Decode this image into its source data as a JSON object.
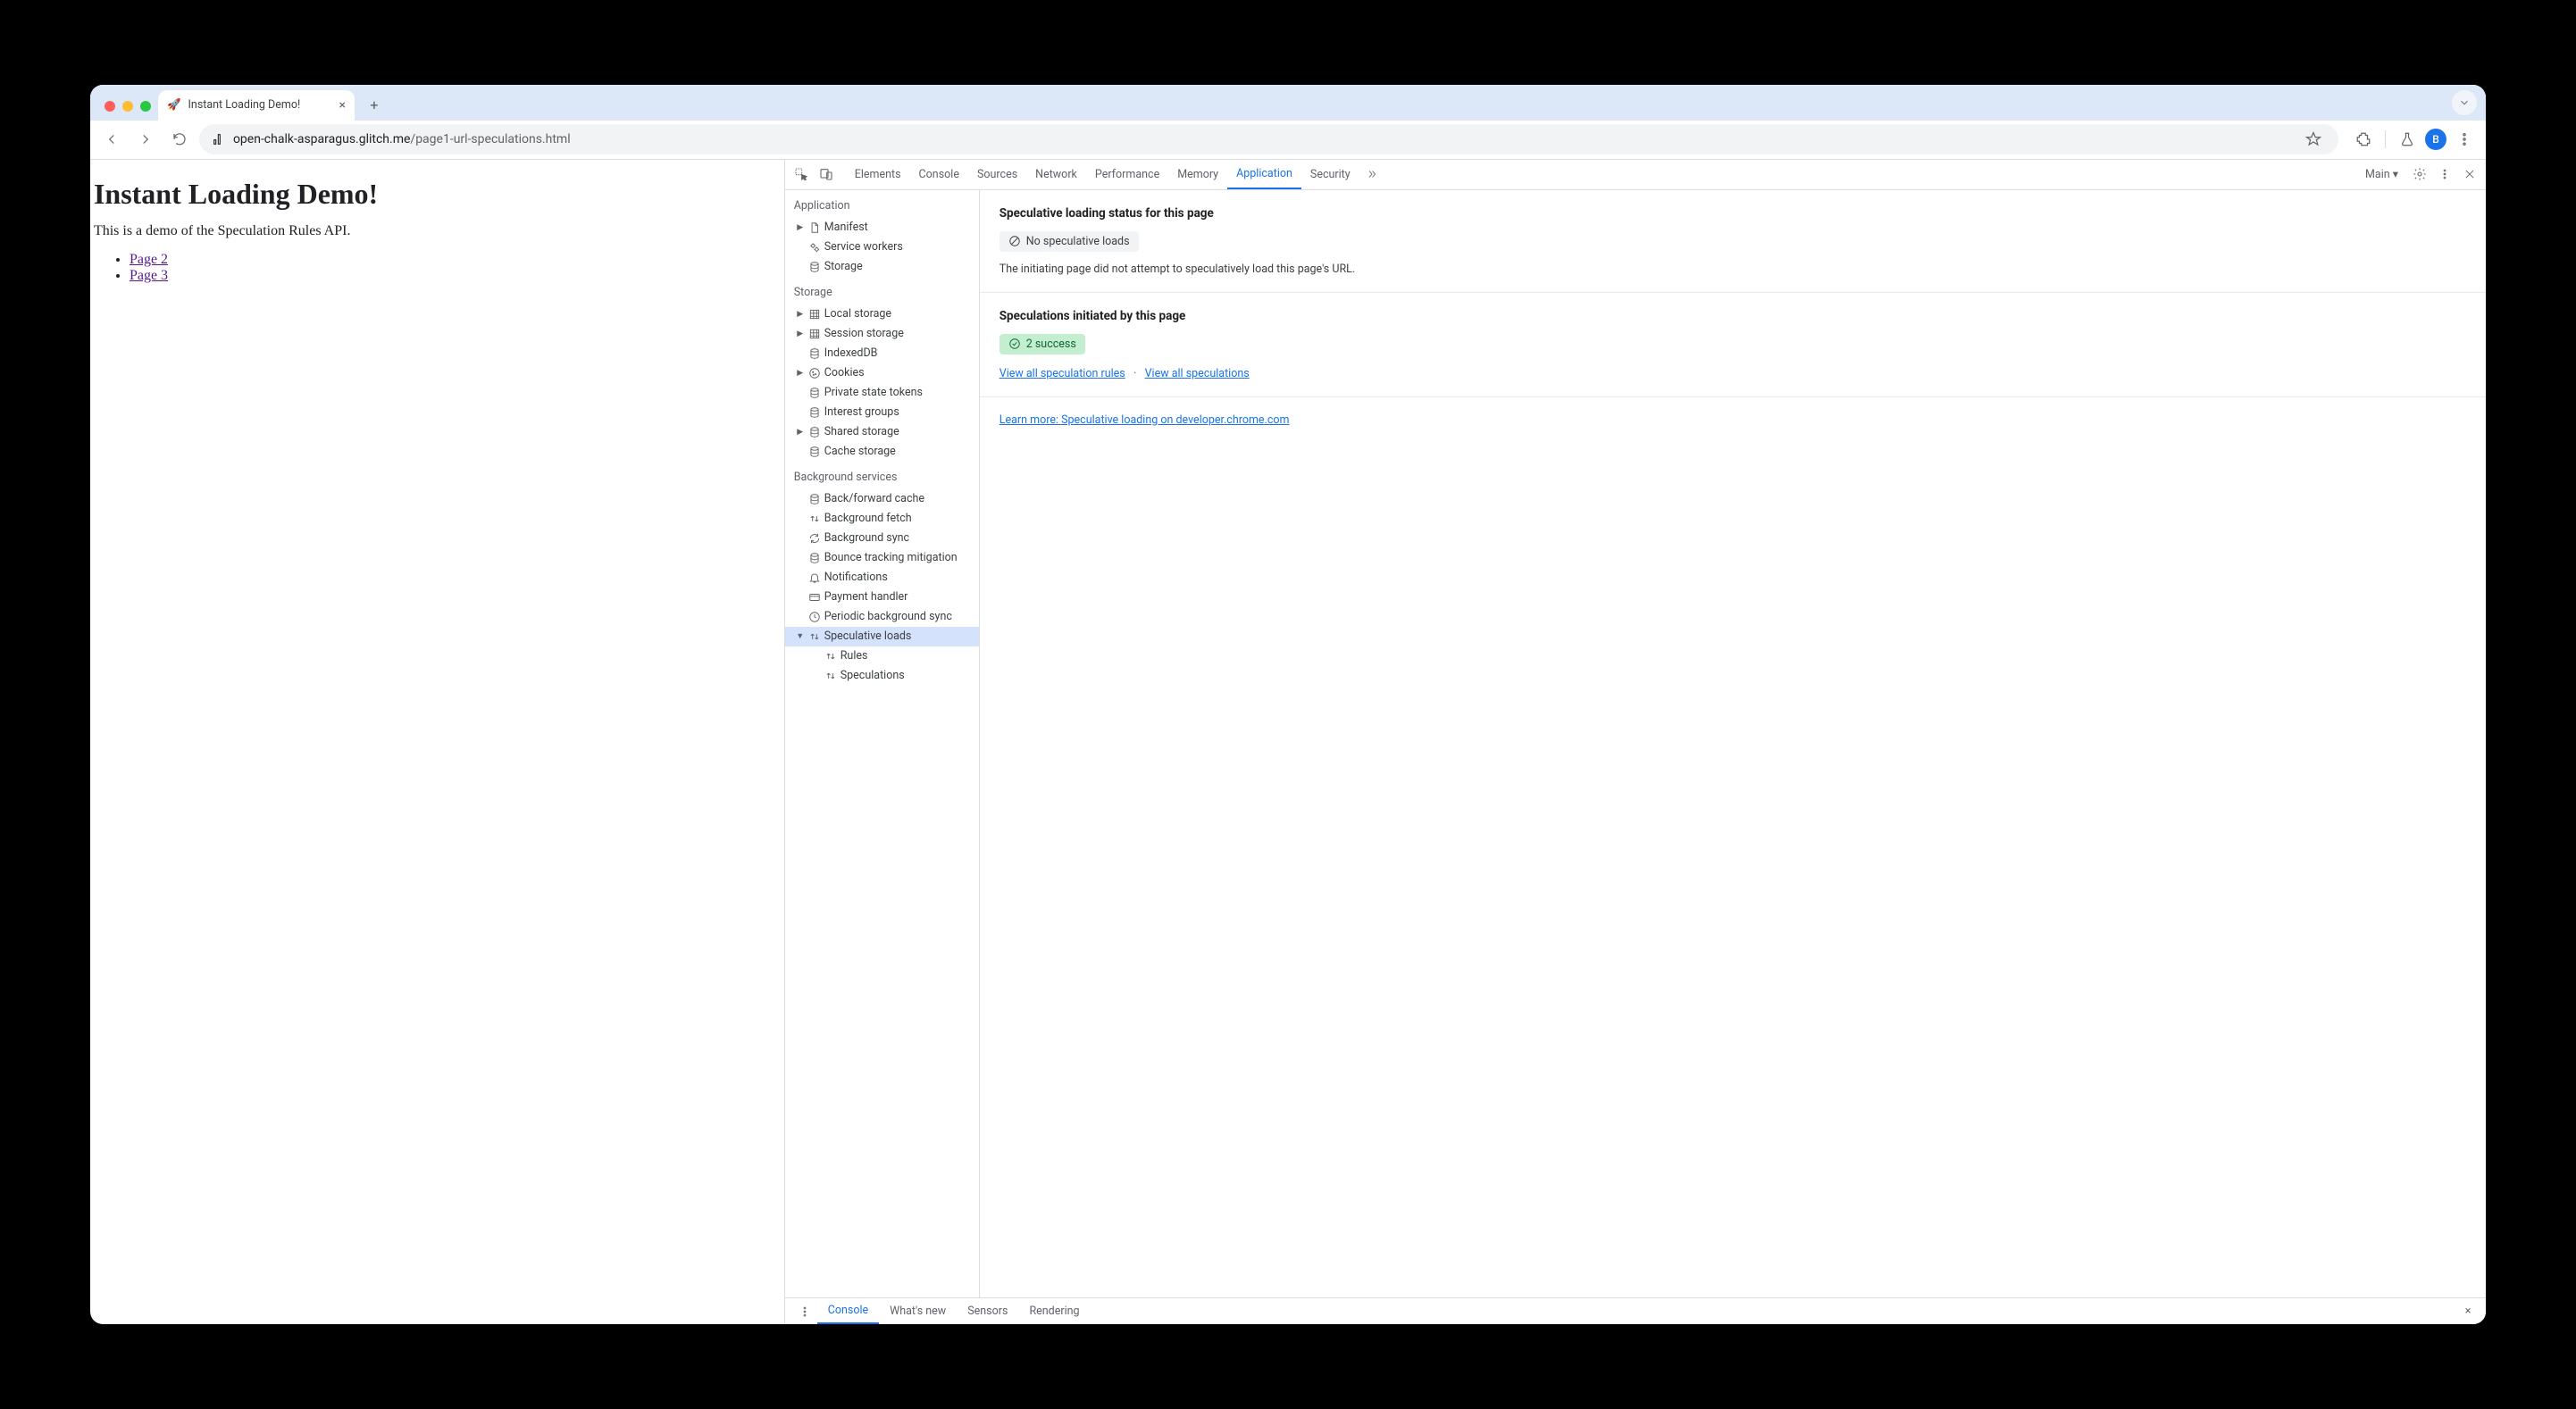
{
  "browser": {
    "tab_title": "Instant Loading Demo!",
    "tab_emoji": "🚀",
    "url_host": "open-chalk-asparagus.glitch.me",
    "url_path": "/page1-url-speculations.html",
    "avatar_letter": "B"
  },
  "page": {
    "heading": "Instant Loading Demo!",
    "paragraph": "This is a demo of the Speculation Rules API.",
    "links": [
      "Page 2",
      "Page 3"
    ]
  },
  "devtools": {
    "target_label": "Main",
    "tabs": [
      "Elements",
      "Console",
      "Sources",
      "Network",
      "Performance",
      "Memory",
      "Application",
      "Security"
    ],
    "active_tab": "Application",
    "sidebar": {
      "sections": [
        {
          "title": "Application",
          "items": [
            {
              "icon": "file",
              "label": "Manifest",
              "expandable": true
            },
            {
              "icon": "gears",
              "label": "Service workers"
            },
            {
              "icon": "db",
              "label": "Storage"
            }
          ]
        },
        {
          "title": "Storage",
          "items": [
            {
              "icon": "grid",
              "label": "Local storage",
              "expandable": true
            },
            {
              "icon": "grid",
              "label": "Session storage",
              "expandable": true
            },
            {
              "icon": "db",
              "label": "IndexedDB"
            },
            {
              "icon": "cookie",
              "label": "Cookies",
              "expandable": true
            },
            {
              "icon": "db",
              "label": "Private state tokens"
            },
            {
              "icon": "db",
              "label": "Interest groups"
            },
            {
              "icon": "db",
              "label": "Shared storage",
              "expandable": true
            },
            {
              "icon": "db",
              "label": "Cache storage"
            }
          ]
        },
        {
          "title": "Background services",
          "items": [
            {
              "icon": "db",
              "label": "Back/forward cache"
            },
            {
              "icon": "updn",
              "label": "Background fetch"
            },
            {
              "icon": "sync",
              "label": "Background sync"
            },
            {
              "icon": "db",
              "label": "Bounce tracking mitigation"
            },
            {
              "icon": "bell",
              "label": "Notifications"
            },
            {
              "icon": "card",
              "label": "Payment handler"
            },
            {
              "icon": "clock",
              "label": "Periodic background sync"
            },
            {
              "icon": "updn",
              "label": "Speculative loads",
              "selected": true,
              "expanded": true,
              "children": [
                {
                  "icon": "updn",
                  "label": "Rules"
                },
                {
                  "icon": "updn",
                  "label": "Speculations"
                }
              ]
            }
          ]
        }
      ]
    },
    "panel": {
      "status_heading": "Speculative loading status for this page",
      "status_badge": "No speculative loads",
      "status_desc": "The initiating page did not attempt to speculatively load this page's URL.",
      "init_heading": "Speculations initiated by this page",
      "init_badge": "2 success",
      "link_rules": "View all speculation rules",
      "link_specs": "View all speculations",
      "learn_more": "Learn more: Speculative loading on developer.chrome.com"
    },
    "drawer_tabs": [
      "Console",
      "What's new",
      "Sensors",
      "Rendering"
    ],
    "drawer_active": "Console"
  }
}
